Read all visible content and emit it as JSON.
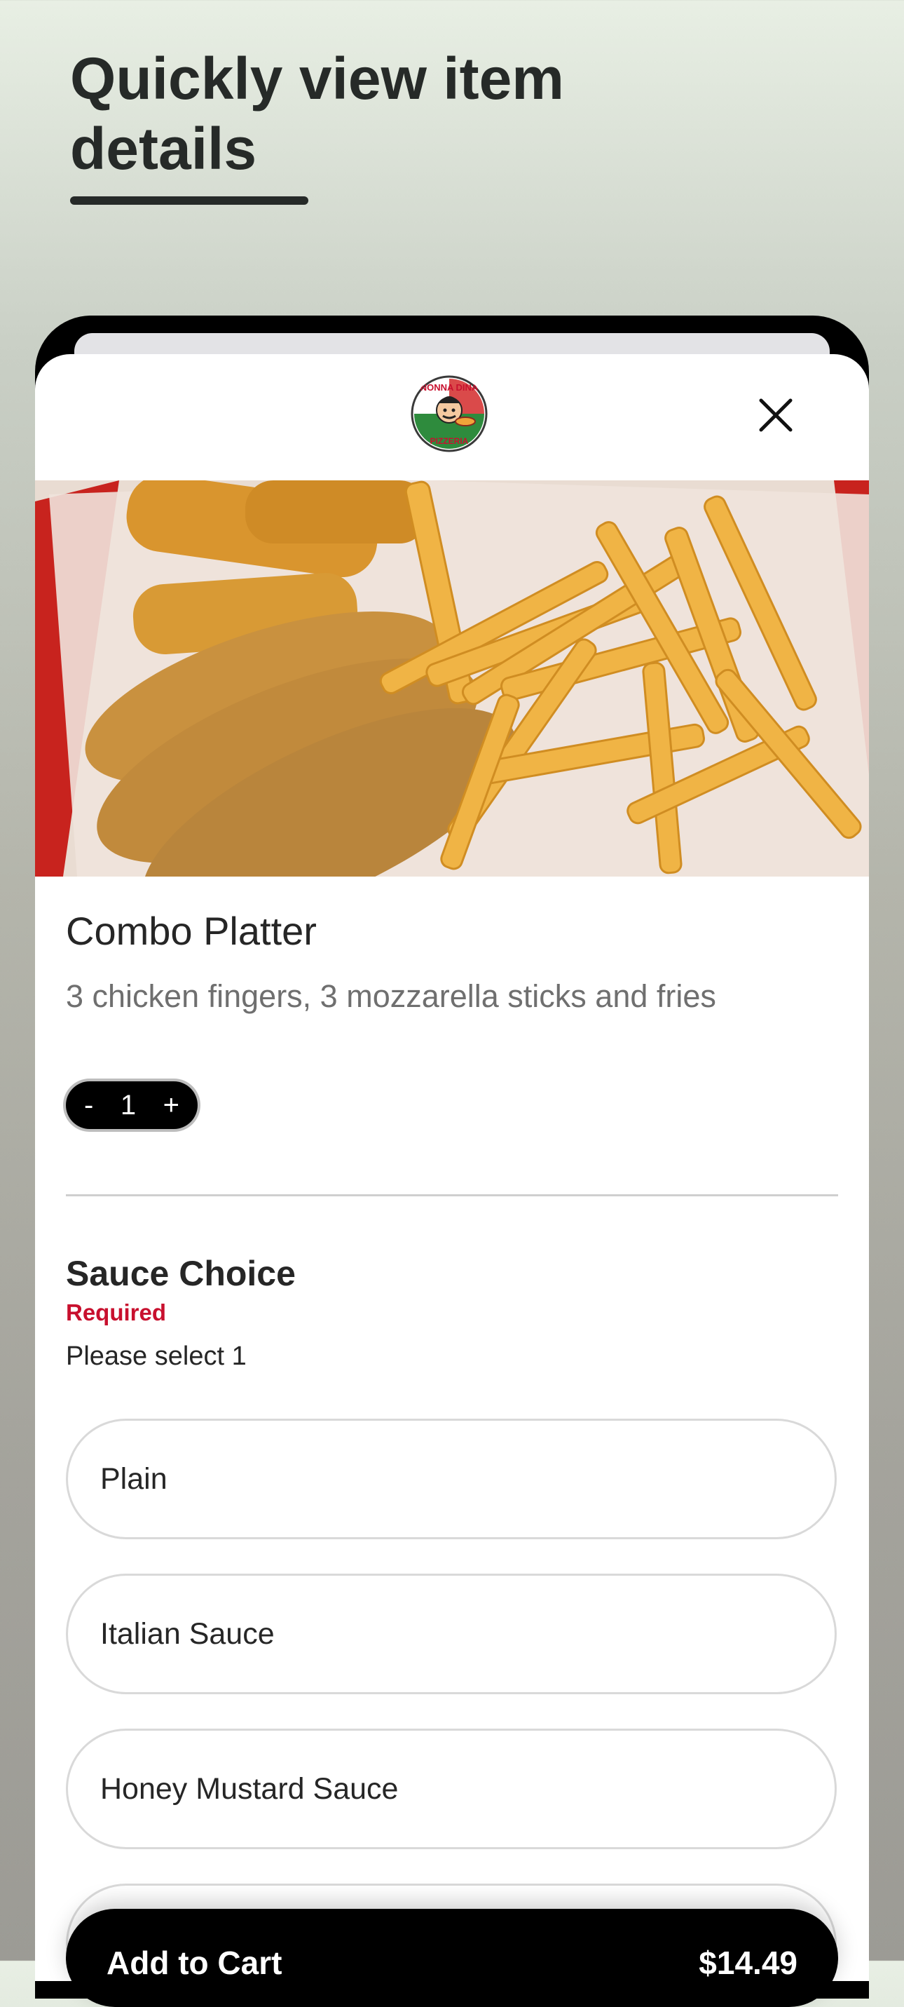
{
  "promo": {
    "title": "Quickly view item details"
  },
  "header": {
    "logo_icon": "pizzeria-logo-icon",
    "logo_text_top": "NONNA DINA",
    "logo_text_bottom": "PIZZERIA",
    "close_icon": "close-icon"
  },
  "item": {
    "image_icon": "food-photo",
    "title": "Combo Platter",
    "description": "3 chicken fingers, 3 mozzarella sticks and fries",
    "quantity": {
      "minus": "-",
      "value": "1",
      "plus": "+"
    }
  },
  "options_group": {
    "title": "Sauce Choice",
    "required_label": "Required",
    "hint": "Please select 1",
    "options": [
      "Plain",
      "Italian Sauce",
      "Honey Mustard Sauce",
      ""
    ]
  },
  "cart": {
    "label": "Add to Cart",
    "price": "$14.49"
  },
  "colors": {
    "accent_required": "#c8102e",
    "button_bg": "#000000"
  }
}
